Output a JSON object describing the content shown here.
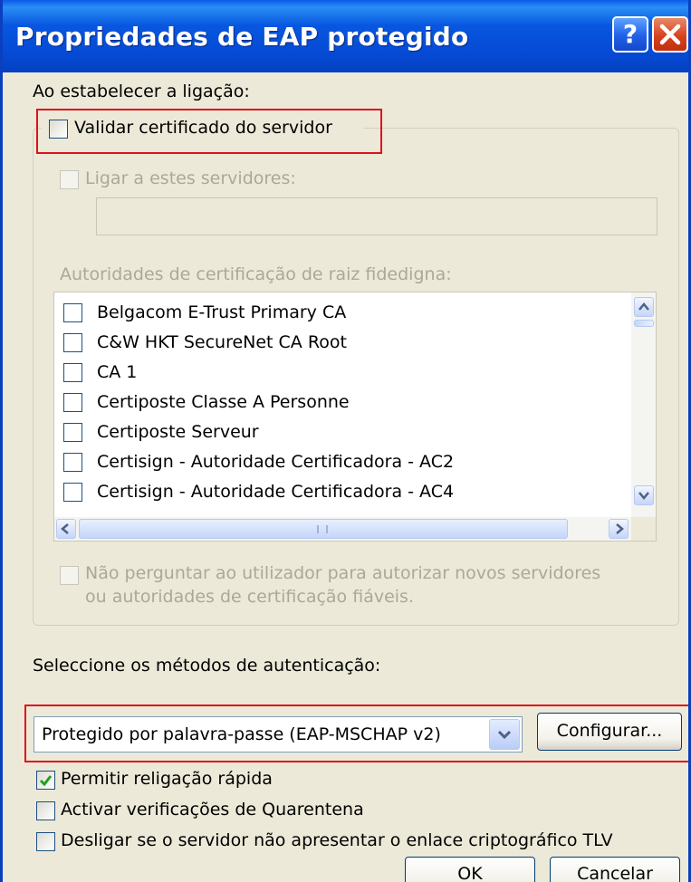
{
  "window": {
    "title": "Propriedades de EAP protegido",
    "help_glyph": "?",
    "close_icon": "close-icon"
  },
  "connect_section": {
    "label": "Ao estabelecer a ligação:",
    "validate_cert": {
      "label": "Validar certificado do servidor",
      "checked": false
    },
    "connect_to_servers": {
      "label": "Ligar a estes servidores:",
      "checked": false,
      "enabled": false,
      "value": ""
    },
    "trusted_roots_label": "Autoridades de certificação de raiz fidedigna:",
    "certificates": [
      {
        "label": "Belgacom E-Trust Primary CA",
        "checked": false
      },
      {
        "label": "C&W HKT SecureNet CA Root",
        "checked": false
      },
      {
        "label": "CA 1",
        "checked": false
      },
      {
        "label": "Certiposte Classe A Personne",
        "checked": false
      },
      {
        "label": "Certiposte Serveur",
        "checked": false
      },
      {
        "label": "Certisign - Autoridade Certificadora - AC2",
        "checked": false
      },
      {
        "label": "Certisign - Autoridade Certificadora - AC4",
        "checked": false
      }
    ],
    "no_prompt_line1": "Não perguntar ao utilizador para autorizar novos servidores",
    "no_prompt_line2": "ou autoridades de certificação fiáveis."
  },
  "auth_section": {
    "label": "Seleccione os métodos de autenticação:",
    "method": "Protegido por palavra-passe (EAP-MSCHAP v2)",
    "configure_label": "Configurar..."
  },
  "options": [
    {
      "label": "Permitir religação rápida",
      "checked": true
    },
    {
      "label": "Activar verificações de Quarentena",
      "checked": false
    },
    {
      "label": "Desligar se o servidor não apresentar o enlace criptográfico TLV",
      "checked": false
    }
  ],
  "buttons": {
    "ok": "OK",
    "cancel": "Cancelar"
  },
  "colors": {
    "titlebar": "#0A5BE8",
    "dialog_bg": "#ECE9D8",
    "highlight": "#E0101A",
    "check_green": "#21A121"
  }
}
